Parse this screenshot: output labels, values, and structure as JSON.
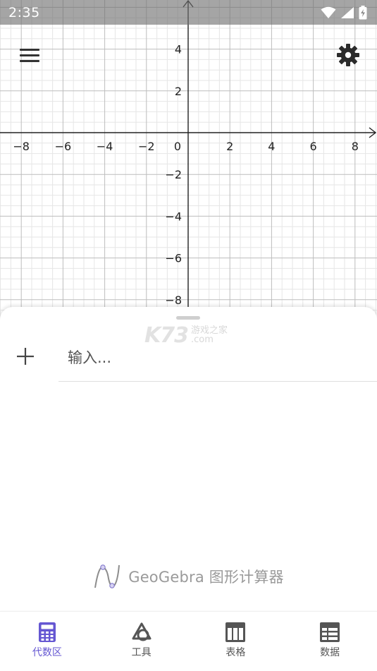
{
  "status_bar": {
    "time": "2:35"
  },
  "graph": {
    "x_ticks": [
      "−8",
      "−6",
      "−4",
      "−2",
      "2",
      "4",
      "6",
      "8"
    ],
    "y_ticks_positive": [
      "4",
      "2"
    ],
    "y_ticks_negative": [
      "−2",
      "−4",
      "−6",
      "−8"
    ],
    "origin_label": "0"
  },
  "algebra": {
    "input_placeholder": "输入..."
  },
  "watermark": {
    "brand": "K73",
    "line1": "游戏之家",
    "line2": ".com"
  },
  "branding": {
    "text": "GeoGebra 图形计算器"
  },
  "nav": {
    "items": [
      {
        "label": "代数区",
        "icon": "calculator-icon",
        "active": true
      },
      {
        "label": "工具",
        "icon": "tools-icon",
        "active": false
      },
      {
        "label": "表格",
        "icon": "table-icon",
        "active": false
      },
      {
        "label": "数据",
        "icon": "data-icon",
        "active": false
      }
    ]
  },
  "colors": {
    "accent": "#6557d2",
    "axis": "#222222",
    "grid_major": "#bdbdbd",
    "grid_minor": "#e6e6e6"
  }
}
